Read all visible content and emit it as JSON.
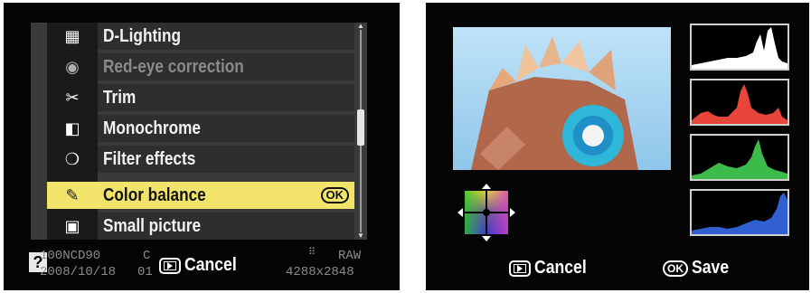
{
  "retouch_menu": {
    "items": [
      {
        "icon": "d-lighting-icon",
        "label": "D-Lighting",
        "state": "normal"
      },
      {
        "icon": "eye-icon",
        "label": "Red-eye correction",
        "state": "disabled"
      },
      {
        "icon": "scissors-icon",
        "label": "Trim",
        "state": "normal"
      },
      {
        "icon": "monochrome-icon",
        "label": "Monochrome",
        "state": "normal"
      },
      {
        "icon": "filter-drop-icon",
        "label": "Filter effects",
        "state": "normal"
      },
      {
        "icon": "color-balance-icon",
        "label": "Color balance",
        "state": "selected"
      },
      {
        "icon": "small-picture-icon",
        "label": "Small picture",
        "state": "normal"
      }
    ],
    "ok_label": "OK",
    "scroll_position": 0.45
  },
  "left_status": {
    "help": "?",
    "folder": "100NCD90",
    "frame_letter": "C",
    "date": "2008/10/18",
    "frame_number": "01",
    "cancel_label": "Cancel",
    "quality": "RAW",
    "image_size": "4288x2848"
  },
  "right_screen": {
    "cancel_label": "Cancel",
    "ok_label": "OK",
    "save_label": "Save",
    "histograms": [
      "white",
      "red",
      "green",
      "blue"
    ],
    "colors": {
      "white": "#ffffff",
      "red": "#e8463a",
      "green": "#3dbb4a",
      "blue": "#2f5fd0"
    }
  }
}
